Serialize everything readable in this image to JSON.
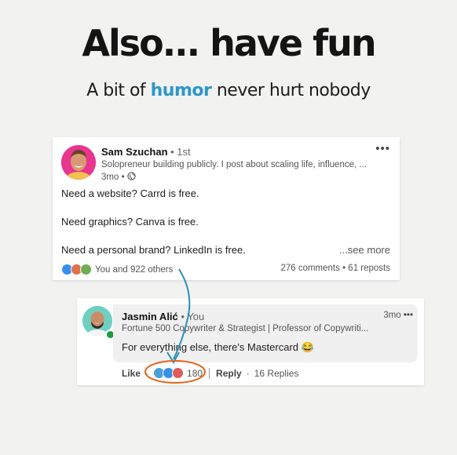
{
  "header": {
    "title": "Also... have fun",
    "subtitle_prefix": "A bit of ",
    "subtitle_accent": "humor",
    "subtitle_suffix": " never hurt nobody"
  },
  "post": {
    "author_name": "Sam Szuchan",
    "author_degree": " • 1st",
    "author_headline": "Solopreneur building publicly. I post about scaling life, influence, ...",
    "time": "3mo •",
    "menu": "•••",
    "lines": [
      "Need a website? Carrd is free.",
      "Need graphics? Canva is free.",
      "Need a personal brand? LinkedIn is free."
    ],
    "see_more": "...see more",
    "reactions_text": "You and 922 others",
    "stats": "276 comments • 61 reposts"
  },
  "comment": {
    "author_name": "Jasmin Alić",
    "author_tag": " • You",
    "time": "3mo",
    "menu": "•••",
    "author_headline": "Fortune 500 Copywriter & Strategist | Professor of Copywriti...",
    "text": "For everything else, there's Mastercard 😂",
    "like_label": "Like",
    "reaction_count": "180",
    "reply_label": "Reply",
    "replies": "16 Replies"
  },
  "colors": {
    "accent": "#2e97c9",
    "annotation": "#e1661e",
    "arrow": "#2b8fb9"
  }
}
